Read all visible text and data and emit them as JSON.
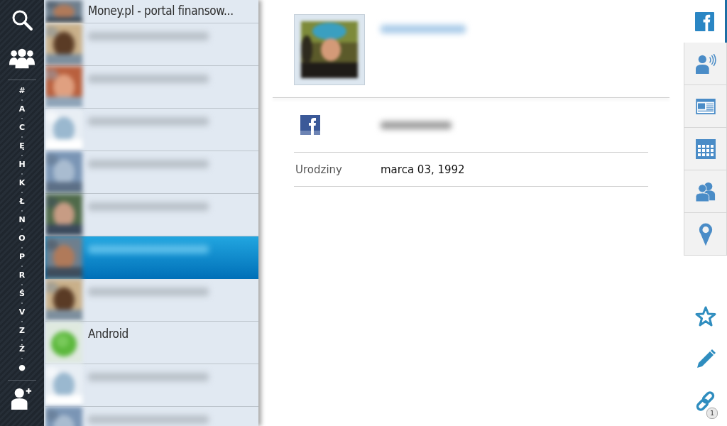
{
  "alphabet_index": [
    "#",
    "A",
    "C",
    "Ę",
    "H",
    "K",
    "Ł",
    "N",
    "O",
    "P",
    "R",
    "Ś",
    "V",
    "Z",
    "Ż",
    "●"
  ],
  "contacts": [
    {
      "kind": "named",
      "name": "Money.pl - portal finansow...",
      "selected": false
    },
    {
      "kind": "redacted",
      "selected": false
    },
    {
      "kind": "redacted",
      "selected": false
    },
    {
      "kind": "redacted",
      "selected": false
    },
    {
      "kind": "redacted",
      "selected": false
    },
    {
      "kind": "redacted",
      "selected": false
    },
    {
      "kind": "redacted",
      "selected": true
    },
    {
      "kind": "redacted",
      "selected": false
    },
    {
      "kind": "named",
      "name": "Android",
      "selected": false
    },
    {
      "kind": "redacted",
      "selected": false
    },
    {
      "kind": "redacted",
      "selected": false
    }
  ],
  "details": {
    "fields": [
      {
        "kind": "facebook"
      },
      {
        "kind": "text",
        "label": "Urodziny",
        "value": "marca 03, 1992"
      }
    ]
  },
  "side_tabs": [
    {
      "kind": "facebook",
      "selected": true
    },
    {
      "kind": "activity",
      "selected": false
    },
    {
      "kind": "news",
      "selected": false
    },
    {
      "kind": "calendar",
      "selected": false
    },
    {
      "kind": "groups",
      "selected": false
    },
    {
      "kind": "location",
      "selected": false
    }
  ],
  "actions": [
    {
      "kind": "favorite"
    },
    {
      "kind": "edit"
    },
    {
      "kind": "link",
      "badge": "1"
    }
  ]
}
